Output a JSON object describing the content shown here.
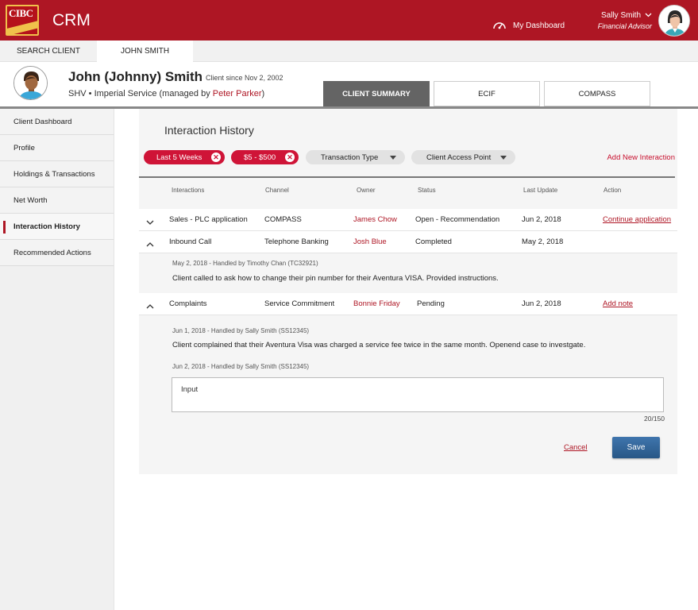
{
  "header": {
    "logo_text": "CIBC",
    "app_name": "CRM",
    "dashboard_label": "My Dashboard",
    "user_name": "Sally Smith",
    "user_role": "Financial Advisor"
  },
  "page_tabs": [
    "SEARCH CLIENT",
    "JOHN SMITH"
  ],
  "client": {
    "name": "John (Johnny) Smith",
    "since": "Client since Nov 2, 2002",
    "service": "SHV • Imperial Service (managed by ",
    "manager": "Peter Parker",
    "service_end": ")"
  },
  "view_tabs": [
    "CLIENT SUMMARY",
    "ECIF",
    "COMPASS"
  ],
  "sidebar": {
    "items": [
      {
        "label": "Client Dashboard"
      },
      {
        "label": "Profile"
      },
      {
        "label": "Holdings & Transactions"
      },
      {
        "label": "Net Worth"
      },
      {
        "label": "Interaction History",
        "active": true
      },
      {
        "label": "Recommended Actions"
      }
    ]
  },
  "main": {
    "title": "Interaction History",
    "filters": {
      "chips": [
        "Last 5 Weeks",
        "$5 - $500"
      ],
      "dropdowns": [
        "Transaction Type",
        "Client Access Point"
      ]
    },
    "add_new": "Add New Interaction",
    "columns": [
      "Interactions",
      "Channel",
      "Owner",
      "Status",
      "Last Update",
      "Action"
    ],
    "rows": [
      {
        "interaction": "Sales - PLC application",
        "channel": "COMPASS",
        "owner": "James Chow",
        "status": "Open - Recommendation",
        "date": "Jun 2, 2018",
        "action": "Continue application",
        "expanded": false
      },
      {
        "interaction": "Inbound Call",
        "channel": "Telephone Banking",
        "owner": "Josh Blue",
        "status": "Completed",
        "date": "May 2, 2018",
        "action": "",
        "expanded": true
      },
      {
        "interaction": "Complaints",
        "channel": "Service Commitment",
        "owner": "Bonnie Friday",
        "status": "Pending",
        "date": "Jun 2, 2018",
        "action": "Add note",
        "expanded": true
      }
    ],
    "call_note": {
      "meta": "May 2, 2018 - Handled by Timothy Chan (TC32921)",
      "text": "Client called to ask how to change their pin number for their Aventura VISA. Provided instructions."
    },
    "complaint_notes": [
      {
        "meta": "Jun 1, 2018 - Handled by Sally Smith (SS12345)",
        "text": "Client complained that their Aventura Visa was charged a service fee twice in the same month. Openend case to investgate."
      },
      {
        "meta": "Jun 2, 2018 - Handled by Sally Smith (SS12345)"
      }
    ],
    "note_input": {
      "value": "Input",
      "counter": "20/150"
    },
    "cancel_label": "Cancel",
    "save_label": "Save"
  },
  "colors": {
    "brand_red": "#ae1624",
    "pill_red": "#cf1437",
    "save_blue": "#285786"
  }
}
